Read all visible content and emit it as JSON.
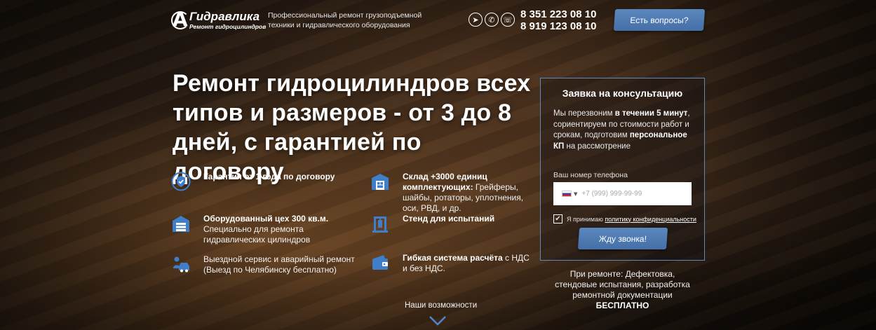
{
  "header": {
    "logo_title": "Гидравлика",
    "logo_sub": "Ремонт гидроцилиндров",
    "tagline": "Профессиональный ремонт грузоподъемной техники и гидравлического оборудования",
    "messengers": [
      "telegram-icon",
      "whatsapp-icon",
      "viber-icon"
    ],
    "phones": [
      "8 351 223 08 10",
      "8 919 123 08 10"
    ],
    "ask_button": "Есть вопросы?"
  },
  "hero": {
    "headline": "Ремонт гидроцилиндров всех типов и размеров - от 3 до 8 дней, с гарантией по договору",
    "features": [
      {
        "bold": "Гарантия от 1 года по договору",
        "text": ""
      },
      {
        "bold": "Оборудованный цех 300 кв.м.",
        "text": " Специально для ремонта гидравлических цилиндров"
      },
      {
        "bold": "",
        "text": "Выездной сервис и аварийный ремонт (Выезд по Челябинску бесплатно)"
      },
      {
        "bold": "Склад +3000 единиц комплектующих:",
        "text": " Грейферы, шайбы, ротаторы, уплотнения, оси, РВД, и др."
      },
      {
        "bold": "Стенд для испытаний",
        "text": ""
      },
      {
        "bold": "Гибкая система расчёта",
        "text": " с НДС и без НДС."
      }
    ],
    "capabilities_link": "Наши возможности"
  },
  "form": {
    "title": "Заявка на консультацию",
    "desc_1": "Мы перезвоним ",
    "desc_bold_1": "в течении 5 минут",
    "desc_2": ", сориентируем по стоимости работ и срокам, подготовим ",
    "desc_bold_2": "персональное КП",
    "desc_3": " на рассмотрение",
    "phone_label": "Ваш номер телефона",
    "phone_placeholder": "+7 (999) 999-99-99",
    "consent_text": "Я принимаю ",
    "consent_link": "политику конфиденциальности",
    "submit": "Жду звонка!"
  },
  "repair_note": {
    "text": "При ремонте: Дефектовка, стендовые испытания, разработка ремонтной документации",
    "bold": "БЕСПЛАТНО"
  },
  "colors": {
    "accent": "#5b87bf",
    "icon_blue": "#3f7fc9"
  }
}
